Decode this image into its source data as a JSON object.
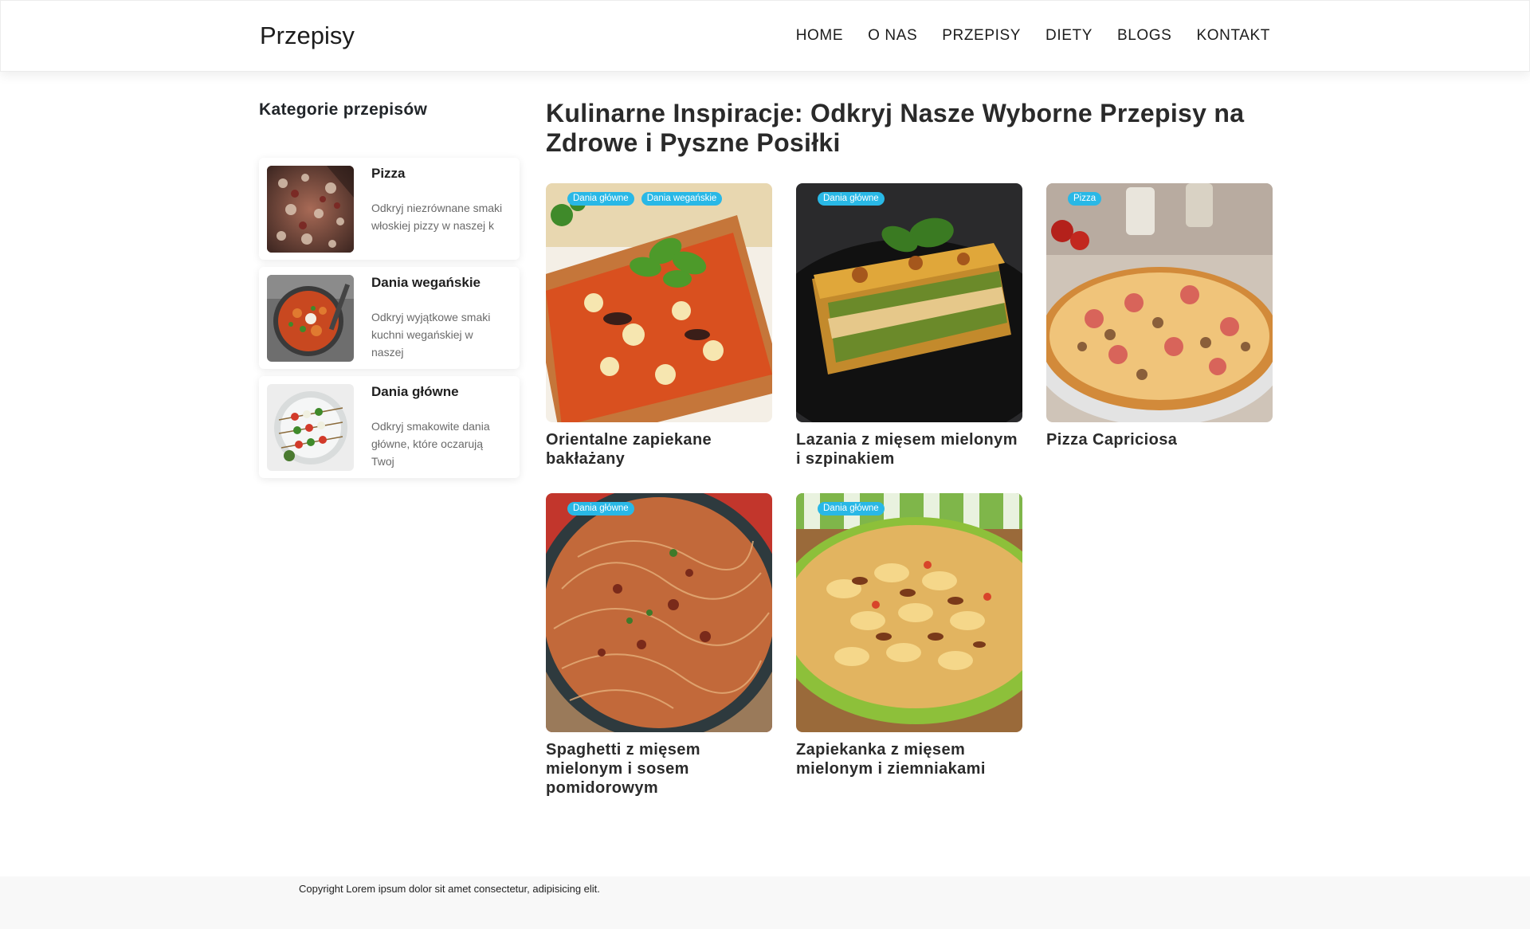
{
  "header": {
    "brand": "Przepisy",
    "nav": [
      "HOME",
      "O NAS",
      "PRZEPISY",
      "DIETY",
      "BLOGS",
      "KONTAKT"
    ]
  },
  "sidebar": {
    "title": "Kategorie przepisów",
    "categories": [
      {
        "name": "Pizza",
        "description": "Odkryj niezrównane smaki włoskiej pizzy w naszej k",
        "image": "pizza-photo"
      },
      {
        "name": "Dania wegańskie",
        "description": "Odkryj wyjątkowe smaki kuchni wegańskiej w naszej",
        "image": "vegan-stew-photo"
      },
      {
        "name": "Dania główne",
        "description": "Odkryj smakowite dania główne, które oczarują Twoj",
        "image": "skewers-photo"
      }
    ]
  },
  "main": {
    "title": "Kulinarne Inspiracje: Odkryj Nasze Wyborne Przepisy na Zdrowe i Pyszne Posiłki",
    "recipes": [
      {
        "title": "Orientalne zapiekane bakłażany",
        "tags": [
          "Dania główne",
          "Dania wegańskie"
        ],
        "image": "eggplant-casserole-photo"
      },
      {
        "title": "Lazania z mięsem mielonym i szpinakiem",
        "tags": [
          "Dania główne"
        ],
        "image": "lasagna-photo"
      },
      {
        "title": "Pizza Capriciosa",
        "tags": [
          "Pizza"
        ],
        "image": "pizza-capriciosa-photo"
      },
      {
        "title": "Spaghetti z mięsem mielonym i sosem pomidorowym",
        "tags": [
          "Dania główne"
        ],
        "image": "spaghetti-photo"
      },
      {
        "title": "Zapiekanka z mięsem mielonym i ziemniakami",
        "tags": [
          "Dania główne"
        ],
        "image": "potato-casserole-photo"
      }
    ]
  },
  "footer": {
    "copyright": "Copyright Lorem ipsum dolor sit amet consectetur, adipisicing elit."
  },
  "colors": {
    "badge": "#29b8e6",
    "footer_bg": "#f8f8f8",
    "text": "#212529"
  }
}
